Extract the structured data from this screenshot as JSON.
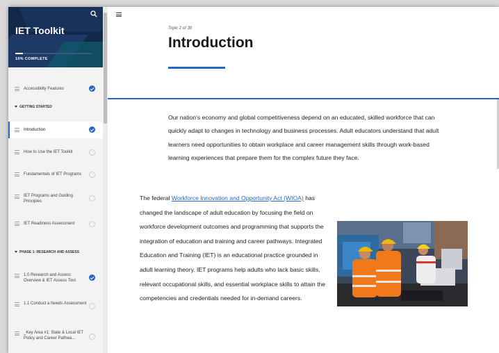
{
  "sidebar": {
    "title": "IET Toolkit",
    "progress_label": "10% COMPLETE",
    "progress_fraction": 0.1,
    "items": [
      {
        "label": "Accessibility Features",
        "done": true
      },
      {
        "label": "Introduction",
        "done": true,
        "active": true
      },
      {
        "label": "How to Use the IET Toolkit",
        "done": false
      },
      {
        "label": "Fundamentals of IET Programs",
        "done": false
      },
      {
        "label": "IET Programs and Guiding Principles",
        "done": false
      },
      {
        "label": "IET Readiness Assessment",
        "done": false
      },
      {
        "label": "1.0 Research and Assess Overview & IET Assess Tool",
        "done": true
      },
      {
        "label": "1.1 Conduct a Needs Assessment",
        "done": false
      },
      {
        "label": "_Key Area #1: State & Local IET Policy and Career Pathwa...",
        "done": false
      }
    ],
    "sections": [
      "GETTING STARTED",
      "PHASE 1: RESEARCH AND ASSESS"
    ]
  },
  "main": {
    "topic_label": "Topic 2 of 30",
    "title": "Introduction",
    "intro": "Our nation’s economy and global competitiveness depend on an educated, skilled workforce that can quickly adapt to changes in technology and business processes. Adult educators understand that adult learners need opportunities to obtain workplace and career management skills through work-based learning experiences that prepare them for the complex future they face.",
    "body_prefix": "The federal ",
    "body_link": "Workforce Innovation and Opportunity Act (WIOA)",
    "body_rest": " has changed the landscape of adult education by focusing the field on workforce development outcomes and programming that supports the integration of education and training and career pathways. Integrated Education and Training (IET) is an educational practice grounded in adult learning theory. IET programs help adults who lack basic skills, relevant occupational skills, and essential workplace skills to attain the competencies and credentials needed for in-demand careers."
  },
  "colors": {
    "accent": "#2467c2",
    "sidebar_header": "#13284a"
  },
  "icons": [
    "search-icon",
    "menu-icon",
    "check-icon",
    "list-icon"
  ]
}
